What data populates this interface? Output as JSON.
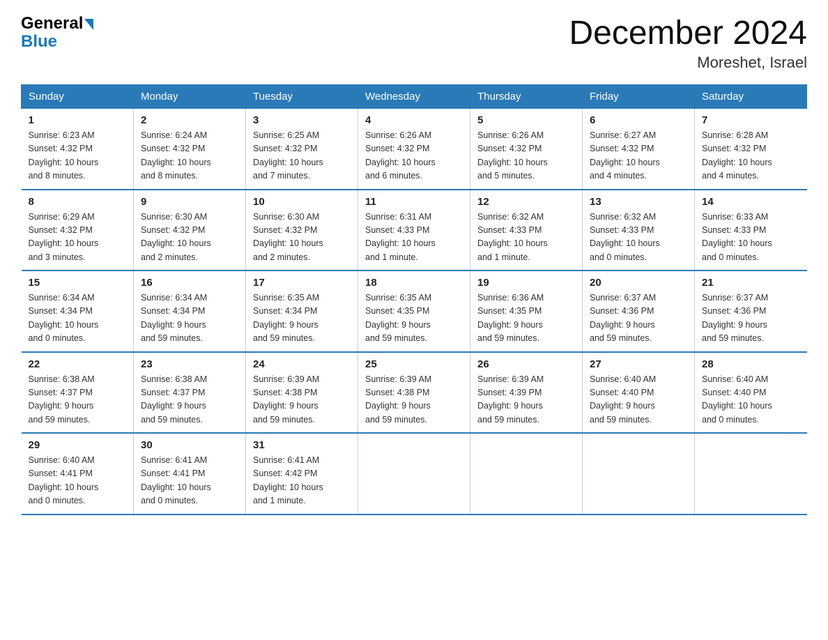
{
  "logo": {
    "general": "General",
    "blue": "Blue"
  },
  "title": "December 2024",
  "subtitle": "Moreshet, Israel",
  "days_header": [
    "Sunday",
    "Monday",
    "Tuesday",
    "Wednesday",
    "Thursday",
    "Friday",
    "Saturday"
  ],
  "weeks": [
    [
      {
        "day": "1",
        "sunrise": "6:23 AM",
        "sunset": "4:32 PM",
        "daylight": "10 hours and 8 minutes."
      },
      {
        "day": "2",
        "sunrise": "6:24 AM",
        "sunset": "4:32 PM",
        "daylight": "10 hours and 8 minutes."
      },
      {
        "day": "3",
        "sunrise": "6:25 AM",
        "sunset": "4:32 PM",
        "daylight": "10 hours and 7 minutes."
      },
      {
        "day": "4",
        "sunrise": "6:26 AM",
        "sunset": "4:32 PM",
        "daylight": "10 hours and 6 minutes."
      },
      {
        "day": "5",
        "sunrise": "6:26 AM",
        "sunset": "4:32 PM",
        "daylight": "10 hours and 5 minutes."
      },
      {
        "day": "6",
        "sunrise": "6:27 AM",
        "sunset": "4:32 PM",
        "daylight": "10 hours and 4 minutes."
      },
      {
        "day": "7",
        "sunrise": "6:28 AM",
        "sunset": "4:32 PM",
        "daylight": "10 hours and 4 minutes."
      }
    ],
    [
      {
        "day": "8",
        "sunrise": "6:29 AM",
        "sunset": "4:32 PM",
        "daylight": "10 hours and 3 minutes."
      },
      {
        "day": "9",
        "sunrise": "6:30 AM",
        "sunset": "4:32 PM",
        "daylight": "10 hours and 2 minutes."
      },
      {
        "day": "10",
        "sunrise": "6:30 AM",
        "sunset": "4:32 PM",
        "daylight": "10 hours and 2 minutes."
      },
      {
        "day": "11",
        "sunrise": "6:31 AM",
        "sunset": "4:33 PM",
        "daylight": "10 hours and 1 minute."
      },
      {
        "day": "12",
        "sunrise": "6:32 AM",
        "sunset": "4:33 PM",
        "daylight": "10 hours and 1 minute."
      },
      {
        "day": "13",
        "sunrise": "6:32 AM",
        "sunset": "4:33 PM",
        "daylight": "10 hours and 0 minutes."
      },
      {
        "day": "14",
        "sunrise": "6:33 AM",
        "sunset": "4:33 PM",
        "daylight": "10 hours and 0 minutes."
      }
    ],
    [
      {
        "day": "15",
        "sunrise": "6:34 AM",
        "sunset": "4:34 PM",
        "daylight": "10 hours and 0 minutes."
      },
      {
        "day": "16",
        "sunrise": "6:34 AM",
        "sunset": "4:34 PM",
        "daylight": "9 hours and 59 minutes."
      },
      {
        "day": "17",
        "sunrise": "6:35 AM",
        "sunset": "4:34 PM",
        "daylight": "9 hours and 59 minutes."
      },
      {
        "day": "18",
        "sunrise": "6:35 AM",
        "sunset": "4:35 PM",
        "daylight": "9 hours and 59 minutes."
      },
      {
        "day": "19",
        "sunrise": "6:36 AM",
        "sunset": "4:35 PM",
        "daylight": "9 hours and 59 minutes."
      },
      {
        "day": "20",
        "sunrise": "6:37 AM",
        "sunset": "4:36 PM",
        "daylight": "9 hours and 59 minutes."
      },
      {
        "day": "21",
        "sunrise": "6:37 AM",
        "sunset": "4:36 PM",
        "daylight": "9 hours and 59 minutes."
      }
    ],
    [
      {
        "day": "22",
        "sunrise": "6:38 AM",
        "sunset": "4:37 PM",
        "daylight": "9 hours and 59 minutes."
      },
      {
        "day": "23",
        "sunrise": "6:38 AM",
        "sunset": "4:37 PM",
        "daylight": "9 hours and 59 minutes."
      },
      {
        "day": "24",
        "sunrise": "6:39 AM",
        "sunset": "4:38 PM",
        "daylight": "9 hours and 59 minutes."
      },
      {
        "day": "25",
        "sunrise": "6:39 AM",
        "sunset": "4:38 PM",
        "daylight": "9 hours and 59 minutes."
      },
      {
        "day": "26",
        "sunrise": "6:39 AM",
        "sunset": "4:39 PM",
        "daylight": "9 hours and 59 minutes."
      },
      {
        "day": "27",
        "sunrise": "6:40 AM",
        "sunset": "4:40 PM",
        "daylight": "9 hours and 59 minutes."
      },
      {
        "day": "28",
        "sunrise": "6:40 AM",
        "sunset": "4:40 PM",
        "daylight": "10 hours and 0 minutes."
      }
    ],
    [
      {
        "day": "29",
        "sunrise": "6:40 AM",
        "sunset": "4:41 PM",
        "daylight": "10 hours and 0 minutes."
      },
      {
        "day": "30",
        "sunrise": "6:41 AM",
        "sunset": "4:41 PM",
        "daylight": "10 hours and 0 minutes."
      },
      {
        "day": "31",
        "sunrise": "6:41 AM",
        "sunset": "4:42 PM",
        "daylight": "10 hours and 1 minute."
      },
      null,
      null,
      null,
      null
    ]
  ],
  "labels": {
    "sunrise": "Sunrise:",
    "sunset": "Sunset:",
    "daylight": "Daylight:"
  }
}
